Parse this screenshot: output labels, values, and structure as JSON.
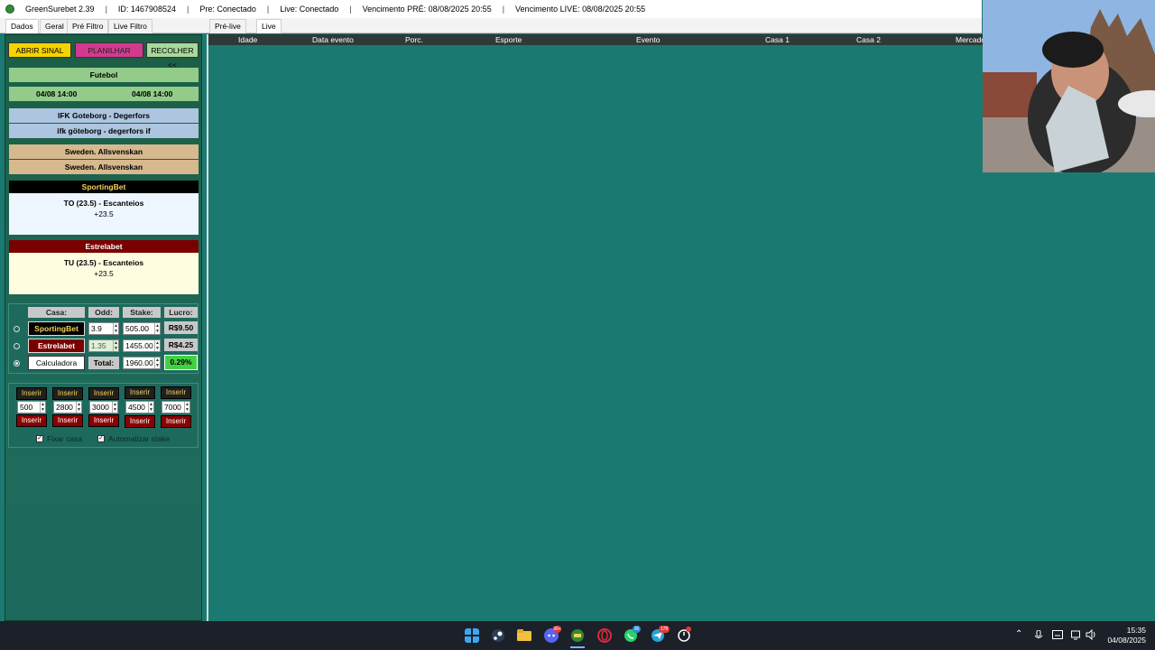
{
  "titlebar": {
    "app": "GreenSurebet 2.39",
    "id": "ID: 1467908524",
    "pre_status": "Pre: Conectado",
    "live_status": "Live: Conectado",
    "vencimento_pre": "Vencimento PRÉ: 08/08/2025 20:55",
    "vencimento_live": "Vencimento LIVE: 08/08/2025 20:55",
    "separator": "|"
  },
  "tabs": {
    "left": [
      "Dados",
      "Geral",
      "Pré Filtro",
      "Live Filtro"
    ],
    "right": [
      "Pré-live",
      "Live"
    ]
  },
  "sidebar": {
    "abrir_sinal": "ABRIR SINAL",
    "planilhar": "PLANILHAR",
    "recolher": "RECOLHER <<",
    "sport": "Futebol",
    "date1": "04/08 14:00",
    "date2": "04/08 14:00",
    "event1": "IFK Goteborg - Degerfors",
    "event2": "ifk göteborg - degerfors if",
    "league1": "Sweden. Allsvenskan",
    "league2": "Sweden. Allsvenskan",
    "house1": {
      "name": "SportingBet",
      "market": "TO (23.5) - Escanteios",
      "line": "+23.5"
    },
    "house2": {
      "name": "Estrelabet",
      "market": "TU (23.5) - Escanteios",
      "line": "+23.5"
    }
  },
  "calc": {
    "headers": {
      "casa": "Casa:",
      "odd": "Odd:",
      "stake": "Stake:",
      "lucro": "Lucro:"
    },
    "rows": [
      {
        "house": "SportingBet",
        "odd": "3.9",
        "stake": "505.00",
        "lucro": "R$9.50"
      },
      {
        "house": "Estrelabet",
        "odd": "1.35",
        "stake": "1455.00",
        "lucro": "R$4.25"
      }
    ],
    "calculadora": "Calculadora",
    "total_label": "Total:",
    "total": "1960.00",
    "percent": "0.29%"
  },
  "inserir": {
    "label": "Inserir",
    "values": [
      "500",
      "2800",
      "3000",
      "4500",
      "7000"
    ]
  },
  "options": {
    "fixar_casa": "Fixar casa",
    "automatizar_stake": "Automatizar stake"
  },
  "grid": {
    "columns": [
      "Idade",
      "Data evento",
      "Porc.",
      "Esporte",
      "Evento",
      "Casa 1",
      "Casa 2",
      "Mercado"
    ]
  },
  "taskbar": {
    "time": "15:35",
    "date": "04/08/2025",
    "badges": {
      "discord": "99+",
      "whatsapp": "36",
      "telegram": "178"
    }
  },
  "colors": {
    "background": "#1a7a72",
    "sportingbet": "#000000",
    "estrelabet": "#7a0000",
    "abrir": "#f5d300",
    "planilhar": "#d23a8e",
    "profit": "#43d143"
  }
}
